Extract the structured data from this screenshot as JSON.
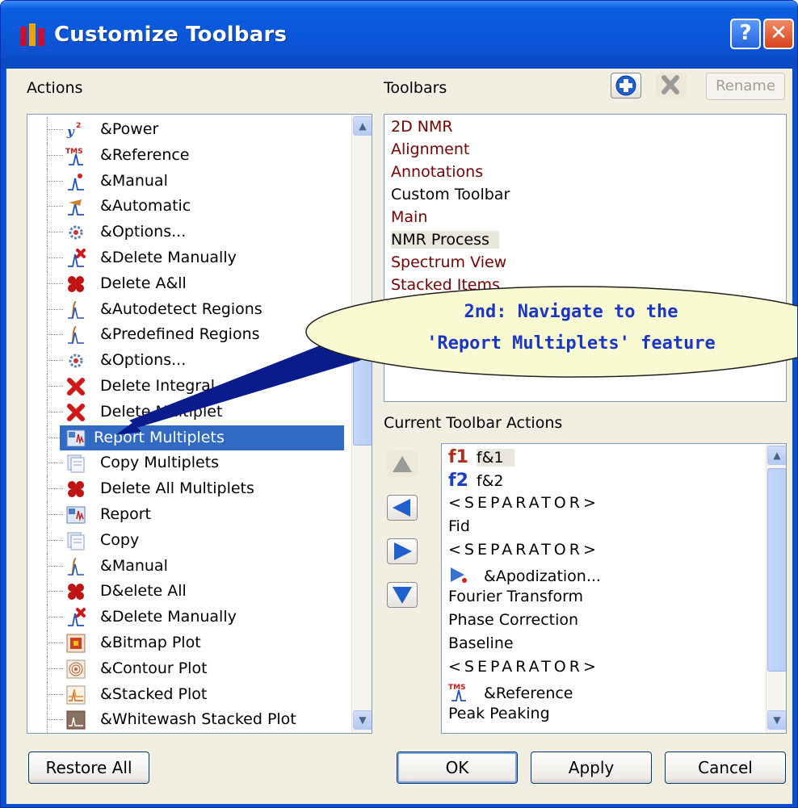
{
  "window": {
    "title": "Customize Toolbars",
    "help_glyph": "?",
    "close_glyph": "✕"
  },
  "actions": {
    "label": "Actions",
    "items": [
      {
        "label": "&Power",
        "icon": "power-icon"
      },
      {
        "label": "&Reference",
        "icon": "tms-reference-icon"
      },
      {
        "label": "&Manual",
        "icon": "manual-icon"
      },
      {
        "label": "&Automatic",
        "icon": "automatic-icon"
      },
      {
        "label": "&Options...",
        "icon": "options-icon"
      },
      {
        "label": "&Delete Manually",
        "icon": "delete-manually-icon"
      },
      {
        "label": "Delete A&ll",
        "icon": "delete-all-icon"
      },
      {
        "label": "&Autodetect Regions",
        "icon": "autodetect-regions-icon"
      },
      {
        "label": "&Predefined Regions",
        "icon": "predefined-regions-icon"
      },
      {
        "label": "&Options...",
        "icon": "options-icon"
      },
      {
        "label": "Delete Integral",
        "icon": "red-x-icon"
      },
      {
        "label": "Delete Multiplet",
        "icon": "red-x-icon"
      },
      {
        "label": "Report Multiplets",
        "icon": "report-multiplets-icon",
        "selected": true
      },
      {
        "label": "Copy Multiplets",
        "icon": "copy-icon"
      },
      {
        "label": "Delete All Multiplets",
        "icon": "delete-all-icon"
      },
      {
        "label": "Report",
        "icon": "report-icon"
      },
      {
        "label": "Copy",
        "icon": "copy-icon"
      },
      {
        "label": "&Manual",
        "icon": "integral-manual-icon"
      },
      {
        "label": "D&elete All",
        "icon": "delete-all-icon"
      },
      {
        "label": "&Delete Manually",
        "icon": "delete-manually-icon"
      },
      {
        "label": "&Bitmap Plot",
        "icon": "bitmap-plot-icon"
      },
      {
        "label": "&Contour Plot",
        "icon": "contour-plot-icon"
      },
      {
        "label": "&Stacked Plot",
        "icon": "stacked-plot-icon"
      },
      {
        "label": "&Whitewash Stacked Plot",
        "icon": "whitewash-plot-icon"
      }
    ]
  },
  "toolbars": {
    "label": "Toolbars",
    "rename_label": "Rename",
    "items": [
      {
        "label": "2D NMR",
        "color": "#7a0000"
      },
      {
        "label": "Alignment",
        "color": "#7a0000"
      },
      {
        "label": "Annotations",
        "color": "#7a0000"
      },
      {
        "label": "Custom Toolbar",
        "color": "#000000"
      },
      {
        "label": "Main",
        "color": "#7a0000"
      },
      {
        "label": "NMR Process",
        "color": "#000000",
        "highlighted": true
      },
      {
        "label": "Spectrum View",
        "color": "#7a0000"
      },
      {
        "label": "Stacked Items",
        "color": "#7a0000"
      }
    ]
  },
  "callout": {
    "line1": "2nd: Navigate to the",
    "line2": "'Report Multiplets' feature"
  },
  "current_actions": {
    "label": "Current Toolbar Actions",
    "items": [
      {
        "label": "f&1",
        "icon": "f1-icon"
      },
      {
        "label": "f&2",
        "icon": "f2-icon"
      },
      {
        "label": "<SEPARATOR>"
      },
      {
        "label": "Fid"
      },
      {
        "label": "<SEPARATOR>"
      },
      {
        "label": "&Apodization...",
        "icon": "apodization-icon"
      },
      {
        "label": "Fourier Transform"
      },
      {
        "label": "Phase Correction"
      },
      {
        "label": "Baseline"
      },
      {
        "label": "<SEPARATOR>"
      },
      {
        "label": "&Reference",
        "icon": "tms-reference-icon"
      },
      {
        "label": "Peak Peaking"
      }
    ],
    "f1_glyph": "f1",
    "f2_glyph": "f2"
  },
  "footer": {
    "restore_label": "Restore All",
    "ok_label": "OK",
    "apply_label": "Apply",
    "cancel_label": "Cancel"
  }
}
